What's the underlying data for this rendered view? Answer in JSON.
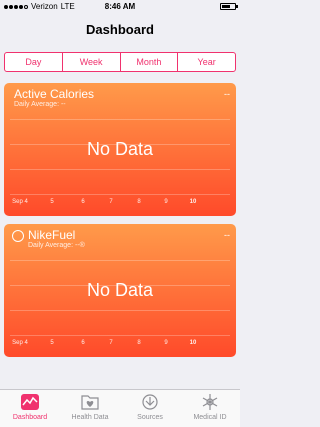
{
  "status_bar": {
    "carrier": "Verizon",
    "network": "LTE",
    "time": "8:46 AM",
    "battery_level": 0.7
  },
  "nav": {
    "title": "Dashboard"
  },
  "segments": [
    "Day",
    "Week",
    "Month",
    "Year"
  ],
  "selected_segment": "Week",
  "cards": [
    {
      "title": "Active Calories",
      "subtitle": "Daily Average: --",
      "value": "--",
      "no_data": "No Data",
      "x_labels": [
        "Sep 4",
        "5",
        "6",
        "7",
        "8",
        "9",
        "10"
      ]
    },
    {
      "title": "NikeFuel",
      "subtitle": "Daily Average: --®",
      "value": "--",
      "no_data": "No Data",
      "x_labels": [
        "Sep 4",
        "5",
        "6",
        "7",
        "8",
        "9",
        "10"
      ]
    }
  ],
  "tabs": [
    "Dashboard",
    "Health Data",
    "Sources",
    "Medical ID"
  ],
  "active_tab": "Dashboard",
  "colors": {
    "accent": "#f0326e",
    "card_top": "#ff9a4a",
    "card_bottom": "#ff4a2a"
  }
}
